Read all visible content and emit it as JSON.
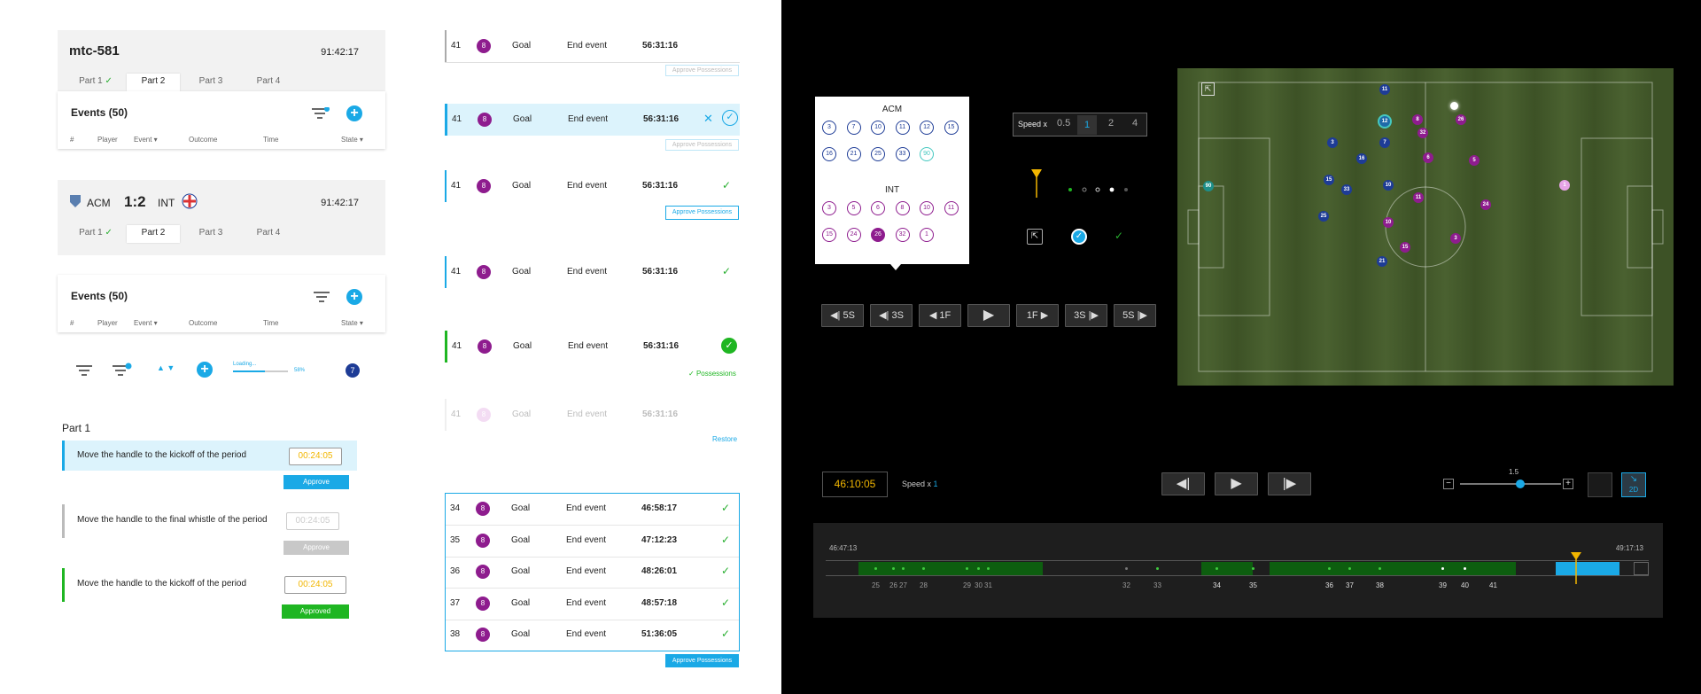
{
  "match1": {
    "id": "mtc-581",
    "clock": "91:42:17",
    "tabs": [
      "Part 1",
      "Part 2",
      "Part 3",
      "Part 4"
    ]
  },
  "match2": {
    "home": "ACM",
    "score": "1:2",
    "away": "INT",
    "clock": "91:42:17",
    "tabs": [
      "Part 1",
      "Part 2",
      "Part 3",
      "Part 4"
    ]
  },
  "events1": {
    "title": "Events (50)",
    "cols": [
      "#",
      "Player",
      "Event ▾",
      "Outcome",
      "Time",
      "State ▾"
    ]
  },
  "events2": {
    "title": "Events (50)",
    "cols": [
      "#",
      "Player",
      "Event ▾",
      "Outcome",
      "Time",
      "State ▾"
    ]
  },
  "toolbar": {
    "loading_label": "Loading...",
    "loading_pct": "58%",
    "loading_fraction": 0.58,
    "badge": "7"
  },
  "part": {
    "title": "Part 1",
    "rows": [
      {
        "text": "Move the handle to the kickoff of the period",
        "time": "00:24:05",
        "button": "Approve"
      },
      {
        "text": "Move the handle to the final whistle of the period",
        "time": "00:24:05",
        "button": "Approve"
      },
      {
        "text": "Move the handle to the kickoff of the period",
        "time": "00:24:05",
        "button": "Approved"
      }
    ]
  },
  "event_cards": [
    {
      "num": "41",
      "player": "8",
      "event": "Goal",
      "outcome": "End event",
      "time": "56:31:16",
      "button": "Approve Possessions"
    },
    {
      "num": "41",
      "player": "8",
      "event": "Goal",
      "outcome": "End event",
      "time": "56:31:16",
      "button": "Approve Possessions"
    },
    {
      "num": "41",
      "player": "8",
      "event": "Goal",
      "outcome": "End event",
      "time": "56:31:16",
      "button": "Approve Possessions"
    },
    {
      "num": "41",
      "player": "8",
      "event": "Goal",
      "outcome": "End event",
      "time": "56:31:16"
    },
    {
      "num": "41",
      "player": "8",
      "event": "Goal",
      "outcome": "End event",
      "time": "56:31:16",
      "status": "Possessions"
    },
    {
      "num": "41",
      "player": "8",
      "event": "Goal",
      "outcome": "End event",
      "time": "56:31:16",
      "link": "Restore"
    }
  ],
  "event_list": {
    "rows": [
      {
        "num": "34",
        "player": "8",
        "event": "Goal",
        "outcome": "End event",
        "time": "46:58:17"
      },
      {
        "num": "35",
        "player": "8",
        "event": "Goal",
        "outcome": "End event",
        "time": "47:12:23"
      },
      {
        "num": "36",
        "player": "8",
        "event": "Goal",
        "outcome": "End event",
        "time": "48:26:01"
      },
      {
        "num": "37",
        "player": "8",
        "event": "Goal",
        "outcome": "End event",
        "time": "48:57:18"
      },
      {
        "num": "38",
        "player": "8",
        "event": "Goal",
        "outcome": "End event",
        "time": "51:36:05"
      }
    ],
    "button": "Approve Possessions"
  },
  "picker": {
    "team1": "ACM",
    "team1_nums": [
      "3",
      "7",
      "10",
      "11",
      "12",
      "15",
      "16",
      "21",
      "25",
      "33",
      "90"
    ],
    "team2": "INT",
    "team2_nums": [
      "3",
      "5",
      "6",
      "8",
      "10",
      "11",
      "15",
      "24",
      "26",
      "32",
      "1"
    ]
  },
  "speed": {
    "label": "Speed x",
    "options": [
      "0.5",
      "1",
      "2",
      "4"
    ],
    "selected": "1"
  },
  "step_buttons": [
    "5S",
    "3S",
    "1F",
    "1F",
    "3S",
    "5S"
  ],
  "player": {
    "time": "46:10:05",
    "speed_label": "Speed x",
    "speed_val": "1",
    "zoom": "1.5",
    "zoom_fraction": 0.6,
    "view": "2D"
  },
  "timeline": {
    "start": "46:47:13",
    "end": "49:17:13",
    "ticks": [
      "25",
      "26",
      "27",
      "28",
      "29",
      "30",
      "31",
      "32",
      "33",
      "34",
      "35",
      "36",
      "37",
      "38",
      "39",
      "40",
      "41"
    ]
  },
  "colors": {
    "accent": "#1aa9e6",
    "green": "#27ae2f",
    "purple": "#8e1c8e",
    "navy": "#1e3c96",
    "gold": "#f2b600"
  }
}
